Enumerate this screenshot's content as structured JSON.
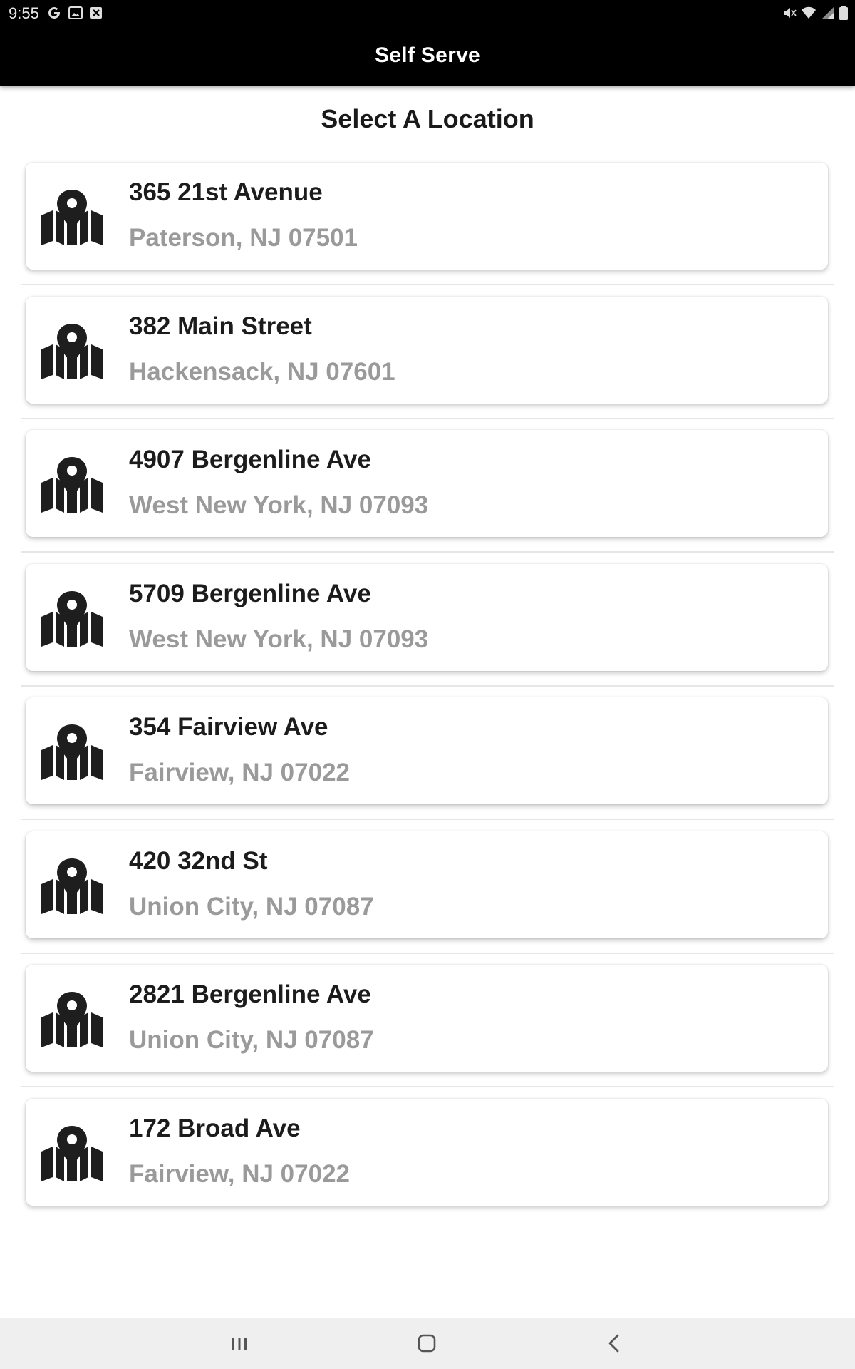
{
  "status_bar": {
    "time": "9:55",
    "left_icons": [
      "google-g-icon",
      "image-icon",
      "close-box-icon"
    ],
    "right_icons": [
      "mute-icon",
      "wifi-icon",
      "signal-icon",
      "battery-icon"
    ]
  },
  "app_bar": {
    "title": "Self Serve"
  },
  "page": {
    "heading": "Select A Location"
  },
  "locations": [
    {
      "street": "365 21st Avenue",
      "city": "Paterson, NJ 07501"
    },
    {
      "street": "382 Main Street",
      "city": "Hackensack, NJ 07601"
    },
    {
      "street": "4907 Bergenline Ave",
      "city": "West New York, NJ 07093"
    },
    {
      "street": "5709 Bergenline Ave",
      "city": "West New York, NJ 07093"
    },
    {
      "street": "354 Fairview Ave",
      "city": "Fairview, NJ 07022"
    },
    {
      "street": "420 32nd St",
      "city": "Union City, NJ 07087"
    },
    {
      "street": "2821 Bergenline Ave",
      "city": "Union City, NJ 07087"
    },
    {
      "street": "172 Broad Ave",
      "city": "Fairview, NJ 07022"
    }
  ],
  "nav_bar": {
    "buttons": [
      "recents-icon",
      "home-icon",
      "back-icon"
    ]
  },
  "colors": {
    "app_bar_bg": "#000000",
    "street_text": "#1c1c1c",
    "city_text": "#9a9a9a",
    "nav_bar_bg": "#efefef"
  }
}
